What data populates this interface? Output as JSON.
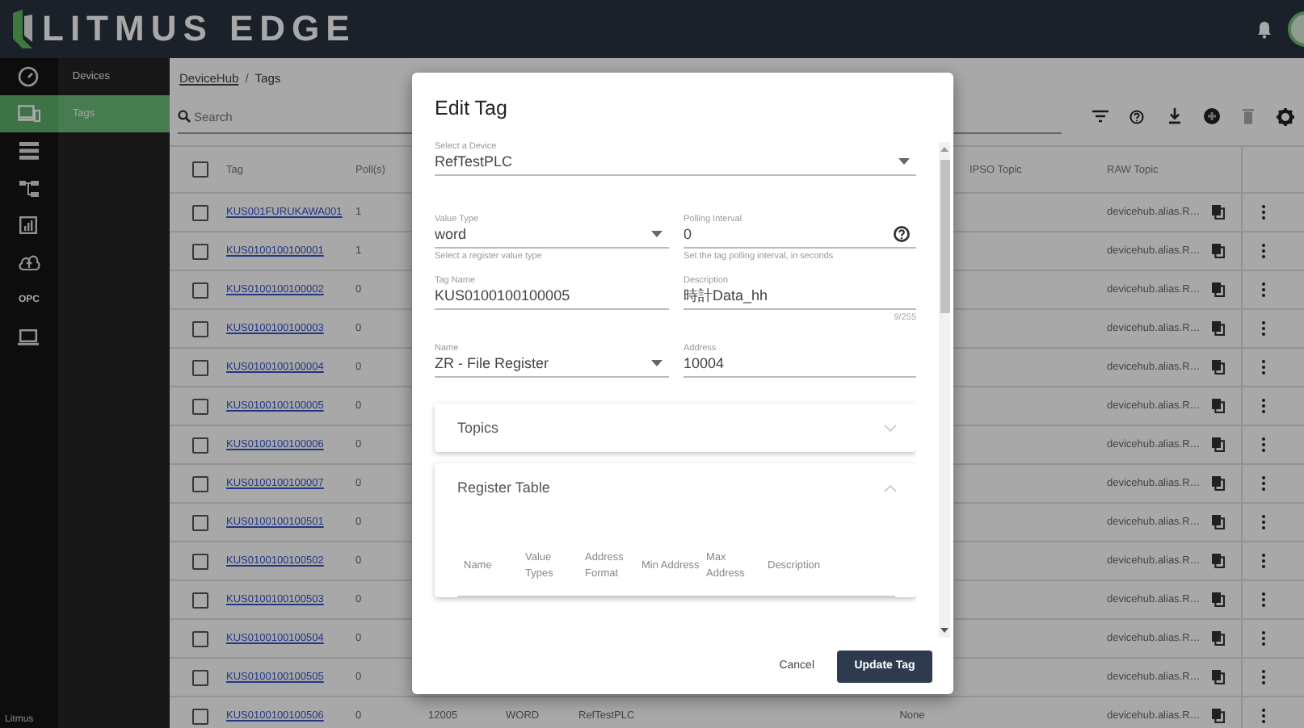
{
  "app": {
    "logo": "LITMUS EDGE",
    "footer": "Litmus"
  },
  "rail": [
    {
      "kind": "gauge",
      "selected": false
    },
    {
      "kind": "devices",
      "selected": true
    },
    {
      "kind": "list",
      "selected": false
    },
    {
      "kind": "tree",
      "selected": false
    },
    {
      "kind": "chart",
      "selected": false
    },
    {
      "kind": "cloud",
      "selected": false
    },
    {
      "kind": "text",
      "label": "OPC",
      "selected": false
    },
    {
      "kind": "laptop",
      "selected": false
    }
  ],
  "submenu": [
    {
      "label": "Devices",
      "selected": false
    },
    {
      "label": "Tags",
      "selected": true
    }
  ],
  "breadcrumb": {
    "parent": "DeviceHub",
    "separator": "/",
    "current": "Tags"
  },
  "search": {
    "placeholder": "Search"
  },
  "toolbar": [
    {
      "kind": "filter",
      "disabled": false
    },
    {
      "kind": "help",
      "disabled": false
    },
    {
      "kind": "download",
      "disabled": false
    },
    {
      "kind": "add",
      "disabled": false
    },
    {
      "kind": "trash",
      "disabled": true
    },
    {
      "kind": "gear",
      "disabled": false
    }
  ],
  "table": {
    "header_checked": false,
    "columns": {
      "tag": "Tag",
      "poll": "Poll(s)",
      "ipso_topic": "IPSO Topic",
      "raw_topic": "RAW Topic"
    },
    "rows": [
      {
        "checked": false,
        "tag": "KUS001FURUKAWA001",
        "poll": "1",
        "raw_topic": "devicehub.alias.R…"
      },
      {
        "checked": false,
        "tag": "KUS0100100100001",
        "poll": "1",
        "raw_topic": "devicehub.alias.R…"
      },
      {
        "checked": false,
        "tag": "KUS0100100100002",
        "poll": "0",
        "raw_topic": "devicehub.alias.R…"
      },
      {
        "checked": false,
        "tag": "KUS0100100100003",
        "poll": "0",
        "raw_topic": "devicehub.alias.R…"
      },
      {
        "checked": false,
        "tag": "KUS0100100100004",
        "poll": "0",
        "raw_topic": "devicehub.alias.R…"
      },
      {
        "checked": false,
        "tag": "KUS0100100100005",
        "poll": "0",
        "raw_topic": "devicehub.alias.R…"
      },
      {
        "checked": false,
        "tag": "KUS0100100100006",
        "poll": "0",
        "raw_topic": "devicehub.alias.R…"
      },
      {
        "checked": false,
        "tag": "KUS0100100100007",
        "poll": "0",
        "raw_topic": "devicehub.alias.R…"
      },
      {
        "checked": false,
        "tag": "KUS0100100100501",
        "poll": "0",
        "raw_topic": "devicehub.alias.R…"
      },
      {
        "checked": false,
        "tag": "KUS0100100100502",
        "poll": "0",
        "raw_topic": "devicehub.alias.R…"
      },
      {
        "checked": false,
        "tag": "KUS0100100100503",
        "poll": "0",
        "raw_topic": "devicehub.alias.R…"
      },
      {
        "checked": false,
        "tag": "KUS0100100100504",
        "poll": "0",
        "raw_topic": "devicehub.alias.R…"
      },
      {
        "checked": false,
        "tag": "KUS0100100100505",
        "poll": "0",
        "raw_topic": "devicehub.alias.R…"
      },
      {
        "checked": false,
        "tag": "KUS0100100100506",
        "poll": "0",
        "column_3": "12005",
        "column_4": "WORD",
        "column_5": "RefTestPLC",
        "column_6": "None",
        "raw_topic": "devicehub.alias.R…"
      }
    ]
  },
  "dialog": {
    "title": "Edit Tag",
    "device_field": {
      "label": "Select a Device",
      "value": "RefTestPLC",
      "kind": "select"
    },
    "fields": [
      {
        "label": "Value Type",
        "value": "word",
        "kind": "select",
        "helper": "Select a register value type"
      },
      {
        "label": "Polling Interval",
        "value": "0",
        "kind": "help",
        "helper": "Set the tag polling interval, in seconds"
      },
      {
        "label": "Tag Name",
        "value": "KUS0100100100005",
        "kind": "text"
      },
      {
        "label": "Description",
        "value": "時計Data_hh",
        "kind": "text",
        "counter": "9/255"
      },
      {
        "label": "Name",
        "value": "ZR - File Register",
        "kind": "select"
      },
      {
        "label": "Address",
        "value": "10004",
        "kind": "text"
      }
    ],
    "panels": [
      {
        "title": "Topics",
        "expanded": false
      },
      {
        "title": "Register Table",
        "expanded": true,
        "columns": [
          "Name",
          "Value Types",
          "Address Format",
          "Min Address",
          "Max Address",
          "Description"
        ]
      }
    ],
    "buttons": [
      {
        "label": "Cancel",
        "kind": "text"
      },
      {
        "label": "Update Tag",
        "kind": "primary"
      }
    ]
  }
}
